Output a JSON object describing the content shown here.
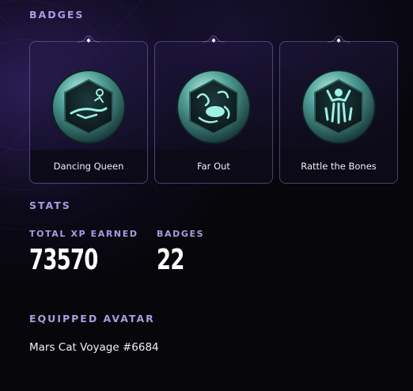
{
  "sections": {
    "badges_title": "BADGES",
    "stats_title": "STATS",
    "equipped_avatar_title": "EQUIPPED AVATAR"
  },
  "badges": [
    {
      "label": "Dancing Queen",
      "icon": "dancer-icon"
    },
    {
      "label": "Far Out",
      "icon": "far-out-icon"
    },
    {
      "label": "Rattle the Bones",
      "icon": "skeleton-icon"
    }
  ],
  "stats": {
    "total_xp_label": "TOTAL XP EARNED",
    "total_xp_value": "73570",
    "badges_label": "BADGES",
    "badges_value": "22"
  },
  "equipped_avatar": {
    "name": "Mars Cat Voyage #6684"
  },
  "colors": {
    "background": "#07060b",
    "accent_label": "#a99ce0",
    "card_border": "#9682dc",
    "medal_teal": "#7fe3d4"
  }
}
